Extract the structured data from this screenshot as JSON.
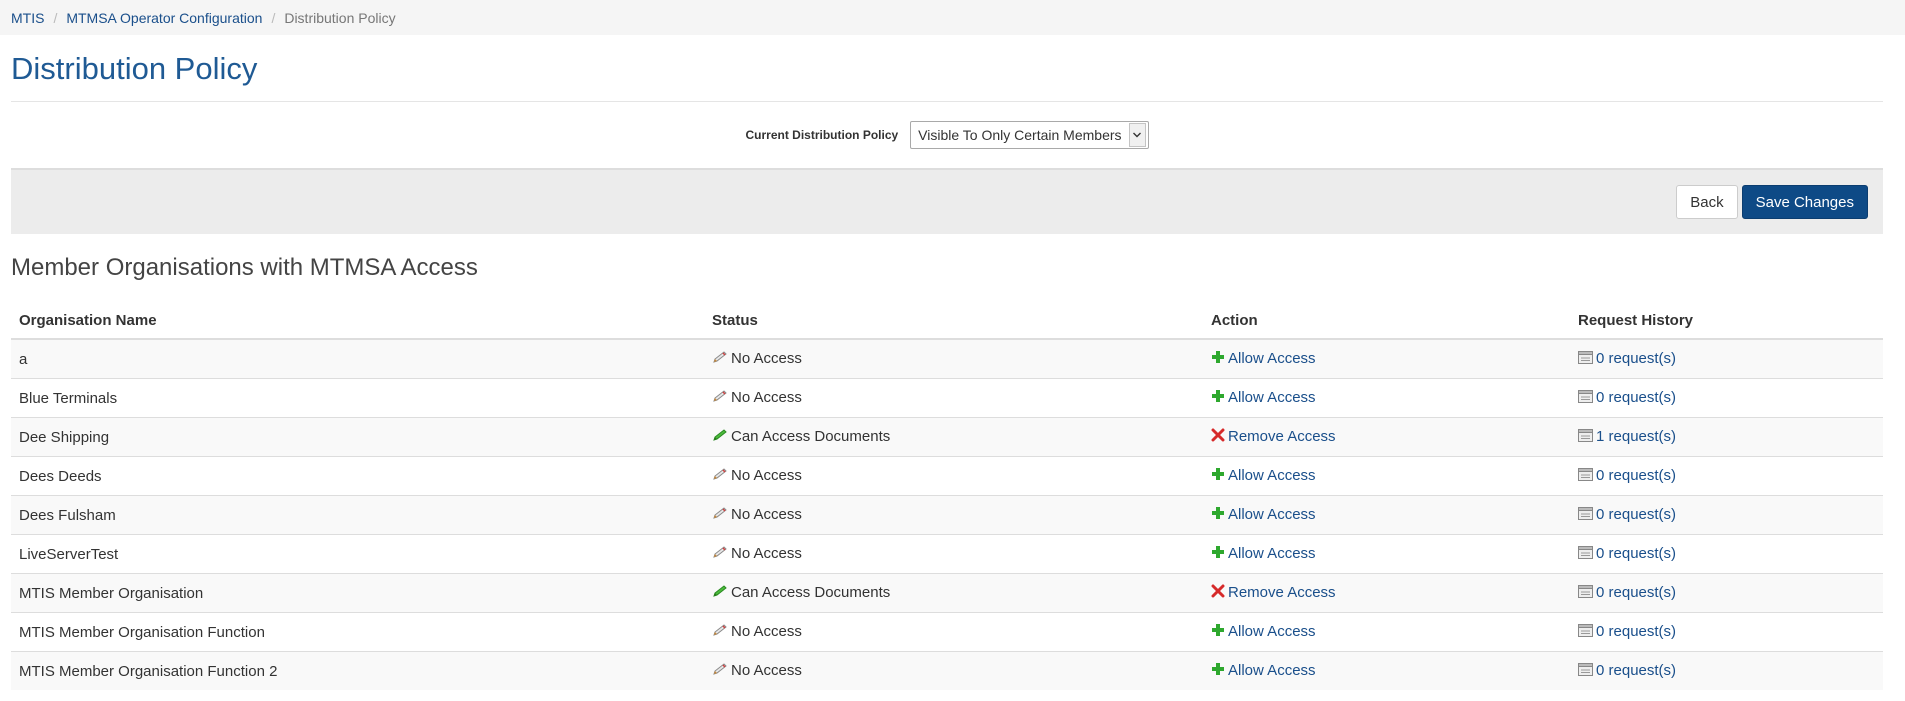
{
  "breadcrumb": {
    "items": [
      "MTIS",
      "MTMSA Operator Configuration"
    ],
    "current": "Distribution Policy"
  },
  "page": {
    "title": "Distribution Policy"
  },
  "policy": {
    "label": "Current Distribution Policy",
    "value": "Visible To Only Certain Members"
  },
  "buttons": {
    "back": "Back",
    "save": "Save Changes"
  },
  "section": {
    "title": "Member Organisations with MTMSA Access"
  },
  "table": {
    "headers": [
      "Organisation Name",
      "Status",
      "Action",
      "Request History"
    ],
    "rows": [
      {
        "name": "a",
        "status": "No Access",
        "status_icon": "pencil-gray-icon",
        "action": "Allow Access",
        "action_icon": "plus-icon",
        "history": "0 request(s)"
      },
      {
        "name": "Blue Terminals",
        "status": "No Access",
        "status_icon": "pencil-gray-icon",
        "action": "Allow Access",
        "action_icon": "plus-icon",
        "history": "0 request(s)"
      },
      {
        "name": "Dee Shipping",
        "status": "Can Access Documents",
        "status_icon": "pencil-green-icon",
        "action": "Remove Access",
        "action_icon": "x-icon",
        "history": "1 request(s)"
      },
      {
        "name": "Dees Deeds",
        "status": "No Access",
        "status_icon": "pencil-gray-icon",
        "action": "Allow Access",
        "action_icon": "plus-icon",
        "history": "0 request(s)"
      },
      {
        "name": "Dees Fulsham",
        "status": "No Access",
        "status_icon": "pencil-gray-icon",
        "action": "Allow Access",
        "action_icon": "plus-icon",
        "history": "0 request(s)"
      },
      {
        "name": "LiveServerTest",
        "status": "No Access",
        "status_icon": "pencil-gray-icon",
        "action": "Allow Access",
        "action_icon": "plus-icon",
        "history": "0 request(s)"
      },
      {
        "name": "MTIS Member Organisation",
        "status": "Can Access Documents",
        "status_icon": "pencil-green-icon",
        "action": "Remove Access",
        "action_icon": "x-icon",
        "history": "0 request(s)"
      },
      {
        "name": "MTIS Member Organisation Function",
        "status": "No Access",
        "status_icon": "pencil-gray-icon",
        "action": "Allow Access",
        "action_icon": "plus-icon",
        "history": "0 request(s)"
      },
      {
        "name": "MTIS Member Organisation Function 2",
        "status": "No Access",
        "status_icon": "pencil-gray-icon",
        "action": "Allow Access",
        "action_icon": "plus-icon",
        "history": "0 request(s)"
      }
    ]
  },
  "colors": {
    "link": "#1a4f8b",
    "primary": "#0e4a86",
    "title": "#1f5a94",
    "plus": "#2ea82e",
    "remove": "#d62a2a"
  }
}
